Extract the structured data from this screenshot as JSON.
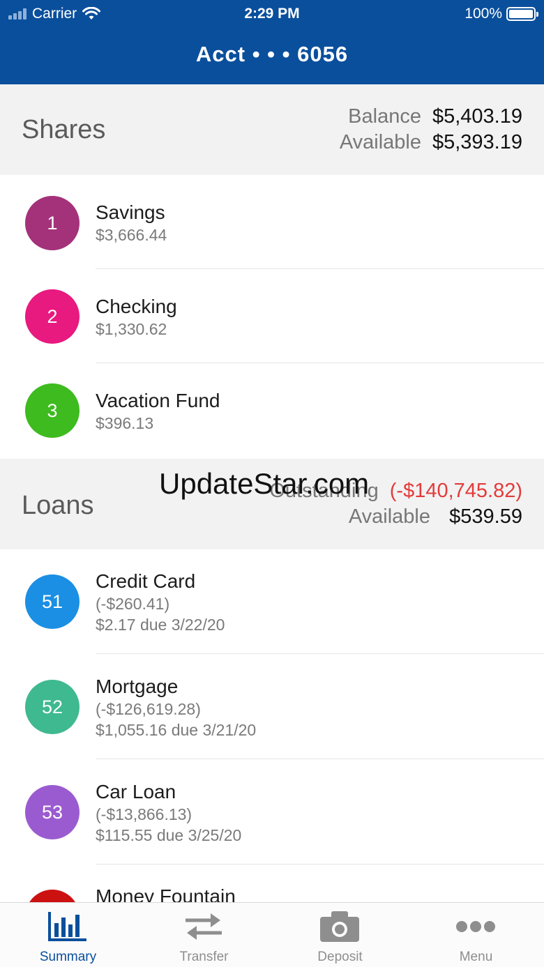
{
  "status_bar": {
    "carrier": "Carrier",
    "time": "2:29 PM",
    "battery": "100%"
  },
  "header": {
    "title": "Acct • • • 6056"
  },
  "shares": {
    "title": "Shares",
    "balance_label": "Balance",
    "balance_value": "$5,403.19",
    "available_label": "Available",
    "available_value": "$5,393.19",
    "accounts": [
      {
        "id": "1",
        "name": "Savings",
        "amount": "$3,666.44",
        "color": "#a3327a"
      },
      {
        "id": "2",
        "name": "Checking",
        "amount": "$1,330.62",
        "color": "#e8197f"
      },
      {
        "id": "3",
        "name": "Vacation Fund",
        "amount": "$396.13",
        "color": "#3dbb1f"
      }
    ]
  },
  "loans": {
    "title": "Loans",
    "outstanding_label": "Outstanding",
    "outstanding_value": "(-$140,745.82)",
    "available_label": "Available",
    "available_value": "$539.59",
    "accounts": [
      {
        "id": "51",
        "name": "Credit Card",
        "balance": "(-$260.41)",
        "due": "$2.17 due 3/22/20",
        "color": "#1a8fe3"
      },
      {
        "id": "52",
        "name": "Mortgage",
        "balance": "(-$126,619.28)",
        "due": "$1,055.16 due 3/21/20",
        "color": "#3fb98f"
      },
      {
        "id": "53",
        "name": "Car Loan",
        "balance": "(-$13,866.13)",
        "due": "$115.55 due 3/25/20",
        "color": "#9b5bd0"
      },
      {
        "id": "",
        "name": "Money Fountain",
        "color": "#cc1111"
      }
    ]
  },
  "watermark": "UpdateStar.com",
  "tabs": [
    {
      "label": "Summary",
      "icon": "bar-chart-icon",
      "active": true
    },
    {
      "label": "Transfer",
      "icon": "transfer-arrows-icon",
      "active": false
    },
    {
      "label": "Deposit",
      "icon": "camera-icon",
      "active": false
    },
    {
      "label": "Menu",
      "icon": "more-dots-icon",
      "active": false
    }
  ],
  "colors": {
    "brand": "#0a4f9c",
    "negative": "#e33b3b"
  }
}
